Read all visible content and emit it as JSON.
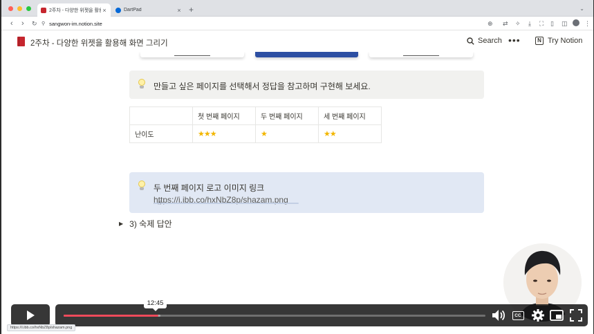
{
  "browser": {
    "tabs": [
      {
        "label": "2주차 - 다양한 위젯을 활용해 화면 그리기",
        "active": true,
        "icon": "red-book-icon"
      },
      {
        "label": "DartPad",
        "active": false,
        "icon": "dartpad-icon"
      }
    ],
    "close_glyph": "×",
    "new_tab_glyph": "+",
    "url": "sangwon-im.notion.site"
  },
  "notion": {
    "page_title": "2주차 - 다양한 위젯을 활용해 화면 그리기",
    "search_label": "Search",
    "more_glyph": "•••",
    "try_label": "Try Notion",
    "logo_letter": "N"
  },
  "callout1": {
    "text": "만들고 싶은 페이지를 선택해서 정답을 참고하며 구현해 보세요."
  },
  "difficulty_table": {
    "headers": [
      "",
      "첫 번째 페이지",
      "두 번째 페이지",
      "세 번째 페이지"
    ],
    "row_label": "난이도",
    "stars": [
      3,
      1,
      2
    ]
  },
  "callout2": {
    "text": "두 번째 페이지 로고 이미지 링크",
    "link": "https://i.ibb.co/hxNbZ8p/shazam.png"
  },
  "toggle": {
    "label": "3) 숙제 답안",
    "glyph": "▶"
  },
  "video": {
    "time_tooltip": "12:45",
    "played_fraction": 0.225,
    "buffered_fraction": 0.23
  },
  "status_url": "https://i.ibb.co/hxNbZ8p/shazam.png",
  "colors": {
    "progress": "#ef4a5b",
    "callout_gray": "#f1f1ef",
    "callout_blue": "#e1e8f4",
    "star": "#f2b600"
  }
}
